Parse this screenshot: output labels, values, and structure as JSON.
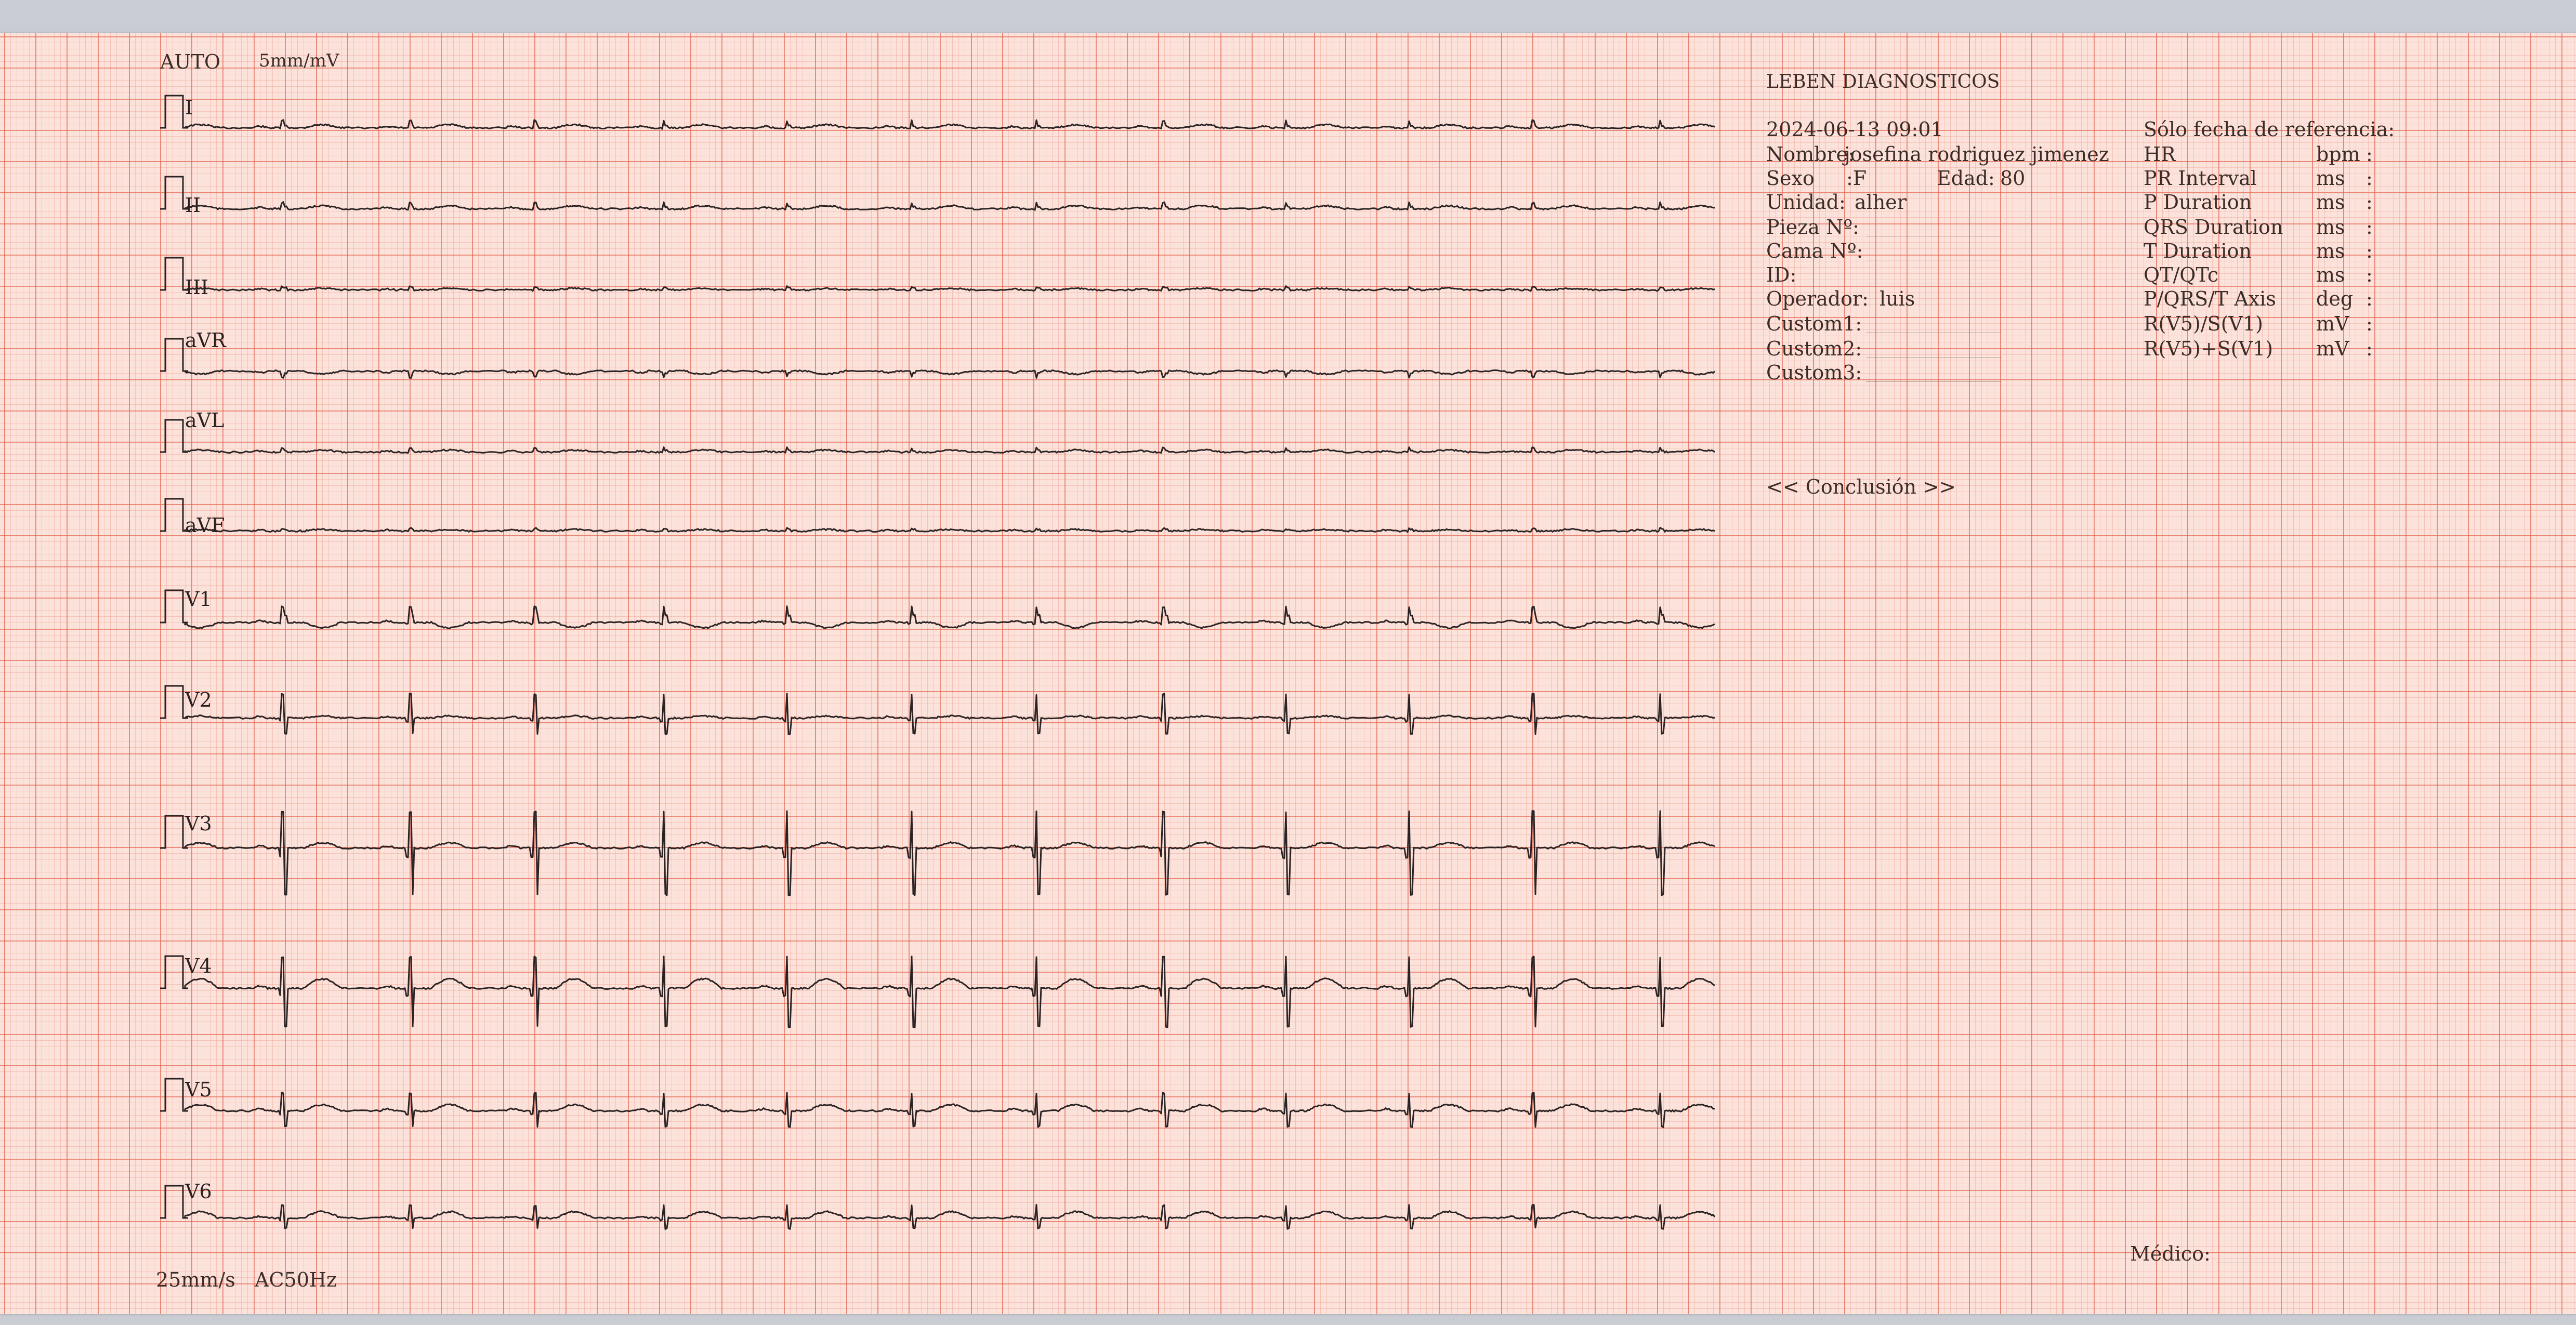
{
  "header": {
    "gain_mode": "AUTO",
    "gain": "5mm/mV"
  },
  "footer": {
    "speed": "25mm/s",
    "filter": "AC50Hz"
  },
  "leads": [
    "I",
    "II",
    "III",
    "aVR",
    "aVL",
    "aVF",
    "V1",
    "V2",
    "V3",
    "V4",
    "V5",
    "V6"
  ],
  "report": {
    "institution": "LEBEN DIAGNOSTICOS",
    "datetime": "2024-06-13 09:01",
    "reference_only": "Sólo fecha de referencia:",
    "patient": {
      "name_label": "Nombre:",
      "name": "josefina rodriguez jimenez",
      "sex_label": "Sexo",
      "sex": ":F",
      "age_label": "Edad:",
      "age": "80",
      "unit_label": "Unidad:",
      "unit": "alher",
      "room_label": "Pieza Nº:",
      "bed_label": "Cama Nº:",
      "id_label": "ID:",
      "operator_label": "Operador:",
      "operator": "luis",
      "custom1_label": "Custom1:",
      "custom2_label": "Custom2:",
      "custom3_label": "Custom3:"
    },
    "measurements": [
      {
        "name": "HR",
        "unit": "bpm",
        "sep": ":"
      },
      {
        "name": "PR Interval",
        "unit": "ms",
        "sep": ":"
      },
      {
        "name": "P Duration",
        "unit": "ms",
        "sep": ":"
      },
      {
        "name": "QRS Duration",
        "unit": "ms",
        "sep": ":"
      },
      {
        "name": "T Duration",
        "unit": "ms",
        "sep": ":"
      },
      {
        "name": "QT/QTc",
        "unit": "ms",
        "sep": ":"
      },
      {
        "name": "P/QRS/T Axis",
        "unit": "deg",
        "sep": ":"
      },
      {
        "name": "R(V5)/S(V1)",
        "unit": "mV",
        "sep": ":"
      },
      {
        "name": "R(V5)+S(V1)",
        "unit": "mV",
        "sep": ":"
      }
    ],
    "conclusion": "<< Conclusión >>",
    "physician_label": "Médico:"
  },
  "colors": {
    "paper": "#fbe3dc",
    "grid_major": "#e25c46",
    "grid_minor": "#ec8270",
    "trace": "#2b2323",
    "text": "#3c2c28"
  }
}
